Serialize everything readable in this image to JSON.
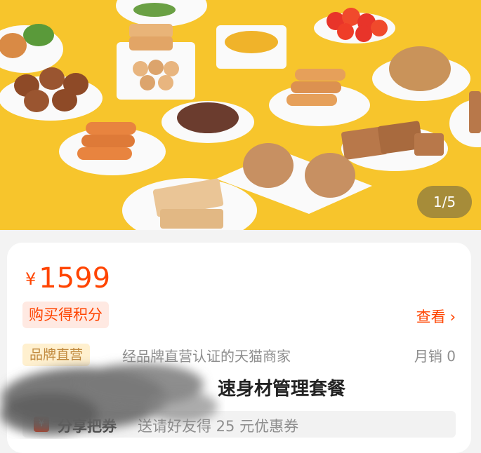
{
  "gallery": {
    "page_indicator": "1/5"
  },
  "product": {
    "price_currency": "¥",
    "price_amount": "1599",
    "points_badge": "购买得积分",
    "view_link": "查看",
    "brand_tag": "品牌直营",
    "brand_description": "经品牌直营认证的天猫商家",
    "monthly_sales": "月销 0",
    "title_visible": "速身材管理套餐"
  },
  "share": {
    "icon_glyph": "¥",
    "label": "分享把券",
    "description": "送请好友得 25 元优惠券"
  },
  "colors": {
    "accent": "#ff4400",
    "hero_background": "#f7c52c",
    "brand_tag_bg": "#fff0cf",
    "brand_tag_text": "#c18a3e"
  }
}
